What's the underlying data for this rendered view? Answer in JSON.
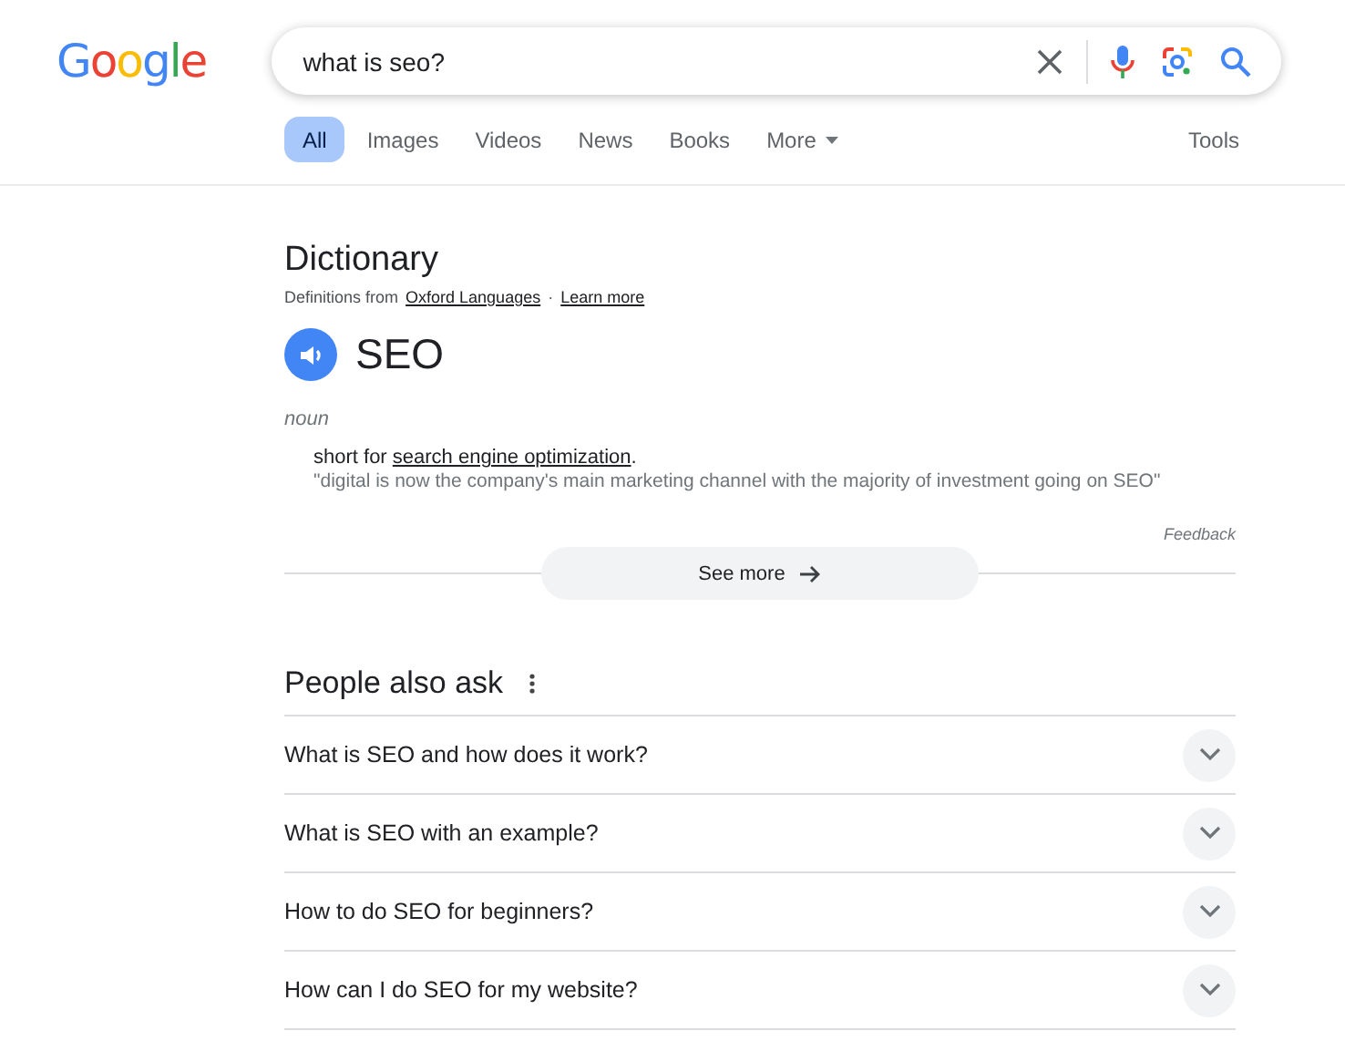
{
  "logo": "Google",
  "search": {
    "value": "what is seo?"
  },
  "tabs": [
    {
      "label": "All",
      "selected": true
    },
    {
      "label": "Images",
      "selected": false
    },
    {
      "label": "Videos",
      "selected": false
    },
    {
      "label": "News",
      "selected": false
    },
    {
      "label": "Books",
      "selected": false
    },
    {
      "label": "More",
      "selected": false,
      "kind": "menu"
    }
  ],
  "tools": "Tools",
  "dictionary": {
    "title": "Dictionary",
    "source_prefix": "Definitions from",
    "source_link": "Oxford Languages",
    "separator": "·",
    "learn_more": "Learn more",
    "word": "SEO",
    "part_of_speech": "noun",
    "definition_prefix": "short for",
    "definition_link": "search engine optimization",
    "definition_suffix": ".",
    "example": "\"digital is now the company's main marketing channel with the majority of investment going on SEO\"",
    "feedback": "Feedback",
    "see_more": "See more"
  },
  "people_also_ask": {
    "title": "People also ask",
    "questions": [
      {
        "text": "What is SEO and how does it work?",
        "expanded": false
      },
      {
        "text": "What is SEO with an example?",
        "expanded": false
      },
      {
        "text": "How to do SEO for beginners?",
        "expanded": false
      },
      {
        "text": "How can I do SEO for my website?",
        "expanded": false
      }
    ]
  }
}
